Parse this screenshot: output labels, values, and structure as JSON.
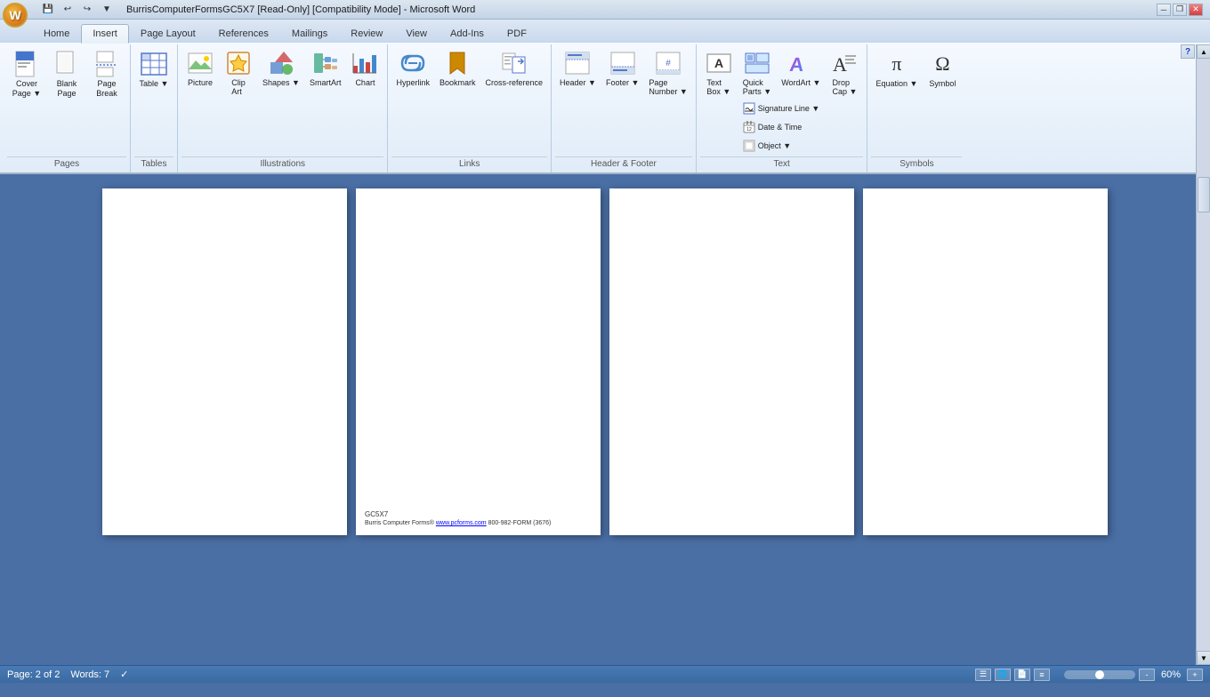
{
  "titlebar": {
    "title": "BurrisComputerFormsGC5X7 [Read-Only] [Compatibility Mode] - Microsoft Word",
    "controls": {
      "minimize": "─",
      "restore": "❐",
      "close": "✕"
    },
    "quickaccess": {
      "save": "💾",
      "undo": "↩",
      "redo": "↪",
      "dropdown": "▼"
    }
  },
  "ribbon": {
    "tabs": [
      "Home",
      "Insert",
      "Page Layout",
      "References",
      "Mailings",
      "Review",
      "View",
      "Add-Ins",
      "PDF"
    ],
    "active_tab": "Insert",
    "groups": {
      "pages": {
        "label": "Pages",
        "buttons": [
          {
            "id": "cover-page",
            "label": "Cover\nPage",
            "icon": "📄",
            "has_dropdown": true
          },
          {
            "id": "blank-page",
            "label": "Blank\nPage",
            "icon": "📃"
          },
          {
            "id": "page-break",
            "label": "Page\nBreak",
            "icon": "⬛"
          }
        ]
      },
      "tables": {
        "label": "Tables",
        "buttons": [
          {
            "id": "table",
            "label": "Table",
            "icon": "⊞",
            "has_dropdown": true
          }
        ]
      },
      "illustrations": {
        "label": "Illustrations",
        "buttons": [
          {
            "id": "picture",
            "label": "Picture",
            "icon": "🖼"
          },
          {
            "id": "clip-art",
            "label": "Clip\nArt",
            "icon": "✂"
          },
          {
            "id": "shapes",
            "label": "Shapes",
            "icon": "◎",
            "has_dropdown": true
          },
          {
            "id": "smartart",
            "label": "SmartArt",
            "icon": "📊"
          },
          {
            "id": "chart",
            "label": "Chart",
            "icon": "📈"
          }
        ]
      },
      "links": {
        "label": "Links",
        "buttons": [
          {
            "id": "hyperlink",
            "label": "Hyperlink",
            "icon": "🔗"
          },
          {
            "id": "bookmark",
            "label": "Bookmark",
            "icon": "🔖"
          },
          {
            "id": "cross-reference",
            "label": "Cross-reference",
            "icon": "↗"
          }
        ]
      },
      "header_footer": {
        "label": "Header & Footer",
        "buttons": [
          {
            "id": "header",
            "label": "Header",
            "icon": "▭",
            "has_dropdown": true
          },
          {
            "id": "footer",
            "label": "Footer",
            "icon": "▬",
            "has_dropdown": true
          },
          {
            "id": "page-number",
            "label": "Page\nNumber",
            "icon": "#",
            "has_dropdown": true
          }
        ]
      },
      "text": {
        "label": "Text",
        "buttons": [
          {
            "id": "text-box",
            "label": "Text\nBox",
            "icon": "☐",
            "has_dropdown": true
          },
          {
            "id": "quick-parts",
            "label": "Quick\nParts",
            "icon": "⚡",
            "has_dropdown": true
          },
          {
            "id": "wordart",
            "label": "WordArt",
            "icon": "A",
            "has_dropdown": true
          },
          {
            "id": "drop-cap",
            "label": "Drop\nCap",
            "icon": "A",
            "has_dropdown": true
          }
        ],
        "small_buttons": [
          {
            "id": "signature-line",
            "label": "Signature Line",
            "has_dropdown": true
          },
          {
            "id": "date-time",
            "label": "Date & Time"
          },
          {
            "id": "object",
            "label": "Object",
            "has_dropdown": true
          }
        ]
      },
      "symbols": {
        "label": "Symbols",
        "buttons": [
          {
            "id": "equation",
            "label": "Equation",
            "icon": "π",
            "has_dropdown": true
          },
          {
            "id": "symbol",
            "label": "Symbol",
            "icon": "Ω",
            "has_dropdown": true
          }
        ]
      }
    }
  },
  "document": {
    "pages": [
      {
        "id": "page1",
        "has_footer": false,
        "footer_text": ""
      },
      {
        "id": "page2",
        "has_footer": true,
        "footer_line1": "GC5X7",
        "footer_line2": "Burris Computer Forms® www.pcforms.com 800-982-FORM (3676)"
      },
      {
        "id": "page3",
        "has_footer": false,
        "footer_text": ""
      },
      {
        "id": "page4",
        "has_footer": false,
        "footer_text": ""
      }
    ]
  },
  "statusbar": {
    "page_info": "Page: 2 of 2",
    "word_count": "Words: 7",
    "zoom_level": "60%",
    "spell_check": "✓"
  }
}
